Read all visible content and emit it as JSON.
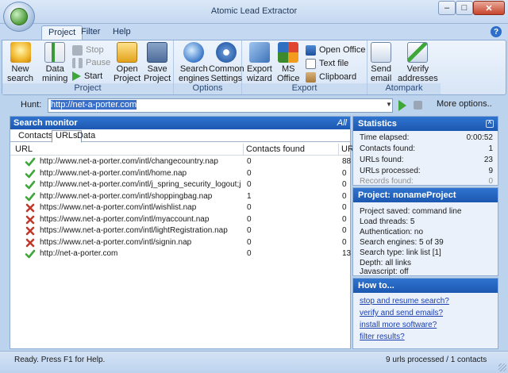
{
  "window": {
    "title": "Atomic Lead Extractor",
    "min": "–",
    "max": "□",
    "close": "✕"
  },
  "ribbon_tabs": [
    "Project",
    "Filter",
    "Help"
  ],
  "help_icon": "?",
  "ribbon": {
    "groups": {
      "project": "Project",
      "options": "Options",
      "export": "Export",
      "atompark": "Atompark"
    },
    "buttons": {
      "new_search": [
        "New",
        "search"
      ],
      "data_mining": [
        "Data",
        "mining"
      ],
      "stop": "Stop",
      "pause": "Pause",
      "start": "Start",
      "open_project": [
        "Open",
        "Project"
      ],
      "save_project": [
        "Save",
        "Project"
      ],
      "search_engines": [
        "Search",
        "engines"
      ],
      "common_settings": [
        "Common",
        "Settings"
      ],
      "export_wizard": [
        "Export",
        "wizard"
      ],
      "ms_office": [
        "MS",
        "Office"
      ],
      "open_office": "Open Office",
      "text_file": "Text file",
      "clipboard": "Clipboard",
      "send_email": [
        "Send",
        "email"
      ],
      "verify_addresses": [
        "Verify",
        "addresses"
      ]
    }
  },
  "hunt": {
    "label": "Hunt:",
    "value": "http://net-a-porter.com",
    "more": "More options.."
  },
  "monitor": {
    "title": "Search monitor",
    "filter": "All",
    "tabs": [
      "Contacts",
      "URLs",
      "Data"
    ],
    "columns": [
      "URL",
      "Contacts found",
      "UR"
    ],
    "rows": [
      {
        "status": "ok",
        "url": "http://www.net-a-porter.com/intl/changecountry.nap",
        "contacts": "0",
        "ur": "88"
      },
      {
        "status": "ok",
        "url": "http://www.net-a-porter.com/intl/home.nap",
        "contacts": "0",
        "ur": "0"
      },
      {
        "status": "ok",
        "url": "http://www.net-a-porter.com/intl/j_spring_security_logout;js",
        "contacts": "0",
        "ur": "0"
      },
      {
        "status": "ok",
        "url": "http://www.net-a-porter.com/intl/shoppingbag.nap",
        "contacts": "1",
        "ur": "0"
      },
      {
        "status": "fail",
        "url": "https://www.net-a-porter.com/intl/wishlist.nap",
        "contacts": "0",
        "ur": "0"
      },
      {
        "status": "fail",
        "url": "https://www.net-a-porter.com/intl/myaccount.nap",
        "contacts": "0",
        "ur": "0"
      },
      {
        "status": "fail",
        "url": "https://www.net-a-porter.com/intl/lightRegistration.nap",
        "contacts": "0",
        "ur": "0"
      },
      {
        "status": "fail",
        "url": "https://www.net-a-porter.com/intl/signin.nap",
        "contacts": "0",
        "ur": "0"
      },
      {
        "status": "ok",
        "url": "http://net-a-porter.com",
        "contacts": "0",
        "ur": "13"
      }
    ]
  },
  "statistics": {
    "title": "Statistics",
    "collapse": "^",
    "items": [
      {
        "label": "Time elapsed:",
        "value": "0:00:52"
      },
      {
        "label": "Contacts found:",
        "value": "1"
      },
      {
        "label": "URLs found:",
        "value": "23"
      },
      {
        "label": "URLs processed:",
        "value": "9"
      },
      {
        "label": "Records found:",
        "value": "0"
      }
    ]
  },
  "project_info": {
    "title": "Project:  nonameProject",
    "lines": [
      "Project saved: command line",
      "Load threads: 5",
      "Authentication: no",
      "Search engines: 5 of 39",
      "Search type: link list [1]",
      "Depth: all links",
      "Javascript: off"
    ]
  },
  "howto": {
    "title": "How to...",
    "links": [
      "stop and resume search?",
      "verify and send emails?",
      "install more software?",
      "filter results?"
    ]
  },
  "status": {
    "left": "Ready. Press F1 for Help.",
    "right": "9 urls processed / 1 contacts"
  },
  "colors": {
    "accent": "#1c58b1",
    "ok": "#3fa63a",
    "fail": "#c0392b",
    "link": "#1a3fb0"
  }
}
